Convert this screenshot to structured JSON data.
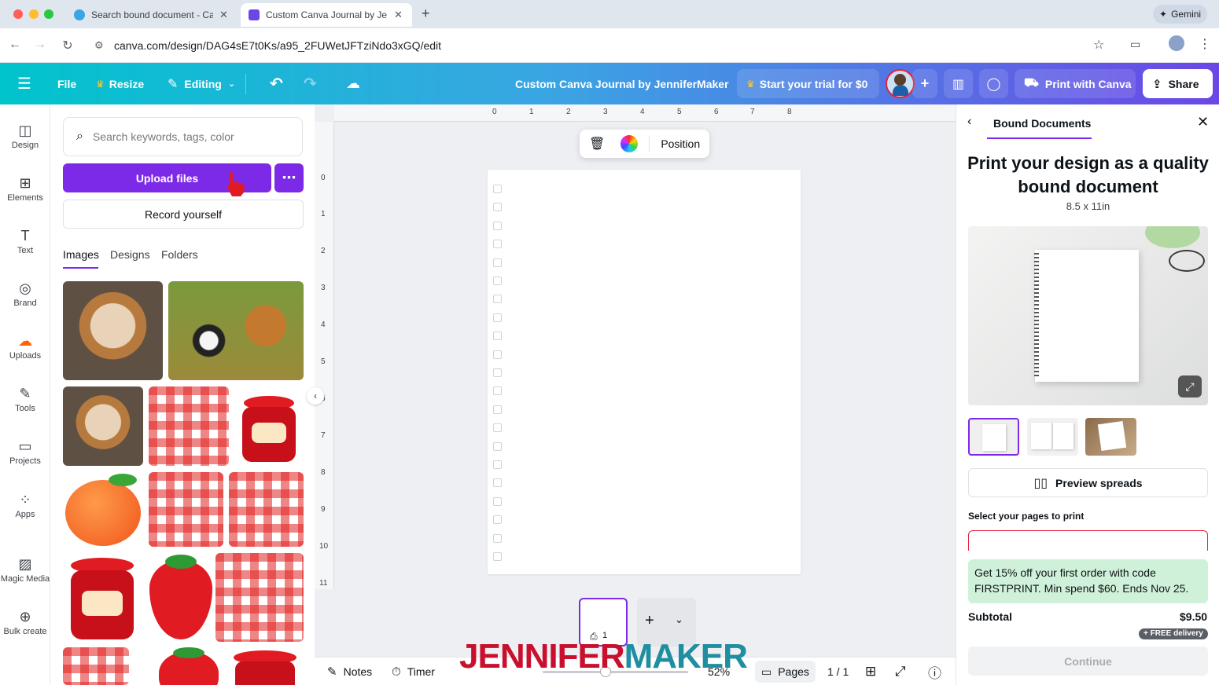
{
  "browser": {
    "tabs": [
      {
        "label": "Search bound document - Ca"
      },
      {
        "label": "Custom Canva Journal by Je"
      }
    ],
    "url": "canva.com/design/DAG4sE7t0Ks/a95_2FUWetJFTziNdo3xGQ/edit",
    "gemini_label": "Gemini"
  },
  "header": {
    "file": "File",
    "resize": "Resize",
    "editing": "Editing",
    "title": "Custom Canva Journal by JenniferMaker",
    "trial": "Start your trial for $0",
    "print": "Print with Canva",
    "share": "Share"
  },
  "rail": [
    {
      "label": "Design",
      "icon": "design-icon"
    },
    {
      "label": "Elements",
      "icon": "elements-icon"
    },
    {
      "label": "Text",
      "icon": "text-icon"
    },
    {
      "label": "Brand",
      "icon": "brand-icon"
    },
    {
      "label": "Uploads",
      "icon": "uploads-icon"
    },
    {
      "label": "Tools",
      "icon": "tools-icon"
    },
    {
      "label": "Projects",
      "icon": "projects-icon"
    },
    {
      "label": "Apps",
      "icon": "apps-icon"
    },
    {
      "label": "Magic Media",
      "icon": "magic-media-icon"
    },
    {
      "label": "Bulk create",
      "icon": "bulk-create-icon"
    }
  ],
  "panel": {
    "search_placeholder": "Search keywords, tags, color",
    "upload": "Upload files",
    "record": "Record yourself",
    "tabs": [
      "Images",
      "Designs",
      "Folders"
    ]
  },
  "canvas": {
    "ruler_top": [
      "0",
      "1",
      "2",
      "3",
      "4",
      "5",
      "6",
      "7",
      "8"
    ],
    "ruler_left": [
      "0",
      "1",
      "2",
      "3",
      "4",
      "5",
      "6",
      "7",
      "8",
      "9",
      "10",
      "11"
    ],
    "context_position": "Position",
    "page_number": "1"
  },
  "bottom": {
    "notes": "Notes",
    "timer": "Timer",
    "zoom": "52%",
    "pages": "Pages",
    "page_count": "1 / 1"
  },
  "right": {
    "tab": "Bound Documents",
    "title": "Print your design as a quality bound document",
    "size": "8.5 x 11in",
    "preview": "Preview spreads",
    "select_label": "Select your pages to print",
    "promo": "Get 15% off your first order with code FIRSTPRINT. Min spend $60. Ends Nov 25.",
    "subtotal_label": "Subtotal",
    "subtotal_value": "$9.50",
    "delivery": "+ FREE delivery",
    "continue": "Continue"
  },
  "watermark": {
    "part1": "JENNIFER",
    "part2": "MAKER"
  },
  "colors": {
    "accent": "#7d2ae8",
    "uploads_active": "#ff6105",
    "promo_bg": "#d0f1d9",
    "watermark_red": "#c8102e",
    "watermark_teal": "#1f8ea0"
  }
}
